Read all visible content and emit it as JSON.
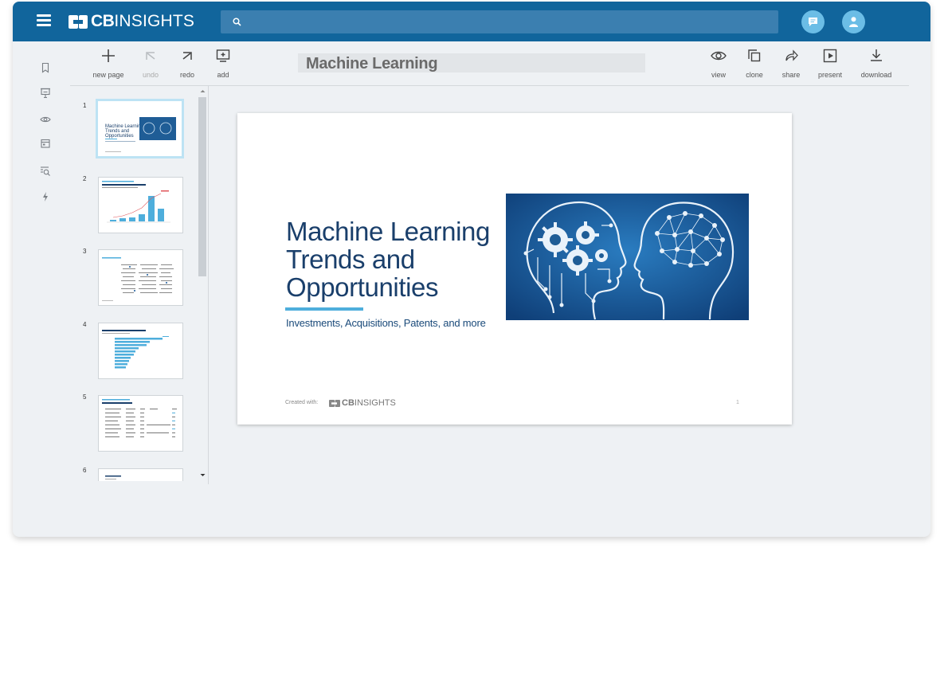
{
  "app": {
    "logo_cb": "CB",
    "logo_insights": "INSIGHTS"
  },
  "search": {
    "placeholder": "",
    "value": ""
  },
  "sidebar": {
    "items": [
      {
        "icon": "bookmark-icon"
      },
      {
        "icon": "presentation-icon"
      },
      {
        "icon": "eye-icon"
      },
      {
        "icon": "calendar-icon"
      },
      {
        "icon": "search-list-icon"
      },
      {
        "icon": "lightning-icon"
      }
    ]
  },
  "toolbar": {
    "new_page": "new page",
    "undo": "undo",
    "redo": "redo",
    "add": "add",
    "view": "view",
    "clone": "clone",
    "share": "share",
    "present": "present",
    "download": "download"
  },
  "document": {
    "title": "Machine Learning"
  },
  "thumbnails": [
    {
      "num": "1",
      "title": "Machine Learning Trends and Opportunities"
    },
    {
      "num": "2",
      "title": "Funding Activity"
    },
    {
      "num": "3",
      "title": "Landscape"
    },
    {
      "num": "4",
      "title": "Top Patent Players"
    },
    {
      "num": "5",
      "title": "Acquisitions Table"
    },
    {
      "num": "6",
      "title": "Patent Topics"
    }
  ],
  "slide": {
    "title_line1": "Machine Learning",
    "title_line2": "Trends and",
    "title_line3": "Opportunities",
    "subtitle": "Investments, Acquisitions, Patents, and more",
    "created_with": "Created with:",
    "footer_cb": "CB",
    "footer_insights": "INSIGHTS",
    "page_number": "1"
  },
  "colors": {
    "topbar": "#11659c",
    "accent": "#4eaedc",
    "slide_title": "#1a3f6b"
  }
}
